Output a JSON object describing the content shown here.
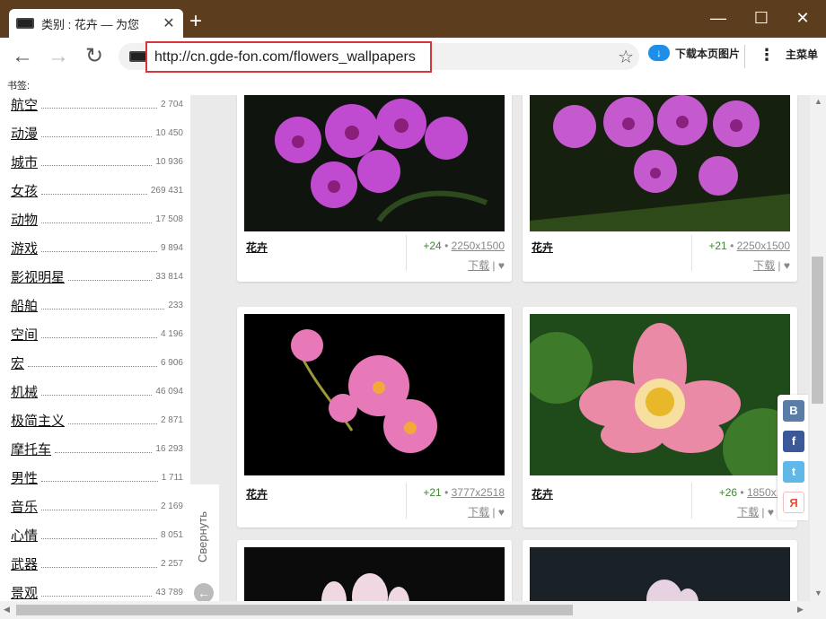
{
  "tab": {
    "title": "类别 : 花卉 — 为您",
    "close": "✕"
  },
  "window": {
    "new_tab": "+",
    "minimize": "—",
    "maximize": "☐",
    "close": "✕"
  },
  "nav": {
    "back": "←",
    "forward": "→",
    "reload": "↻"
  },
  "address": {
    "url": "http://cn.gde-fon.com/flowers_wallpapers",
    "bookmark": "☆"
  },
  "toolbar": {
    "download_label": "下载本页图片",
    "menu_label": "主菜单",
    "menu_dots": "⋮"
  },
  "bookmarks_bar": {
    "label": "书签:"
  },
  "sidebar": {
    "items": [
      {
        "name": "航空",
        "count": "2 704"
      },
      {
        "name": "动漫",
        "count": "10 450"
      },
      {
        "name": "城市",
        "count": "10 936"
      },
      {
        "name": "女孩",
        "count": "269 431"
      },
      {
        "name": "动物",
        "count": "17 508"
      },
      {
        "name": "游戏",
        "count": "9 894"
      },
      {
        "name": "影视明星",
        "count": "33 814"
      },
      {
        "name": "船舶",
        "count": "233"
      },
      {
        "name": "空间",
        "count": "4 196"
      },
      {
        "name": "宏",
        "count": "6 906"
      },
      {
        "name": "机械",
        "count": "46 094"
      },
      {
        "name": "极简主义",
        "count": "2 871"
      },
      {
        "name": "摩托车",
        "count": "16 293"
      },
      {
        "name": "男性",
        "count": "1 711"
      },
      {
        "name": "音乐",
        "count": "2 169"
      },
      {
        "name": "心情",
        "count": "8 051"
      },
      {
        "name": "武器",
        "count": "2 257"
      },
      {
        "name": "景观",
        "count": "43 789"
      }
    ],
    "collapse_label": "Свернуть"
  },
  "cards": [
    {
      "name": "花卉",
      "plus": "+24",
      "res": "2250x1500",
      "download": "下载",
      "heart": "♥"
    },
    {
      "name": "花卉",
      "plus": "+21",
      "res": "2250x1500",
      "download": "下载",
      "heart": "♥"
    },
    {
      "name": "花卉",
      "plus": "+21",
      "res": "3777x2518",
      "download": "下载",
      "heart": "♥"
    },
    {
      "name": "花卉",
      "plus": "+26",
      "res": "1850x18",
      "download": "下载",
      "heart": "♥"
    }
  ],
  "social": {
    "vk": "B",
    "facebook": "f",
    "twitter": "t",
    "yandex": "Я"
  },
  "colors": {
    "frame": "#5c3d1e",
    "url_highlight": "#d9343a",
    "plus_green": "#3c8a2e",
    "vk": "#5a7da8",
    "facebook": "#3b5998",
    "twitter": "#5fb8e8",
    "yandex": "#e84c3d"
  }
}
